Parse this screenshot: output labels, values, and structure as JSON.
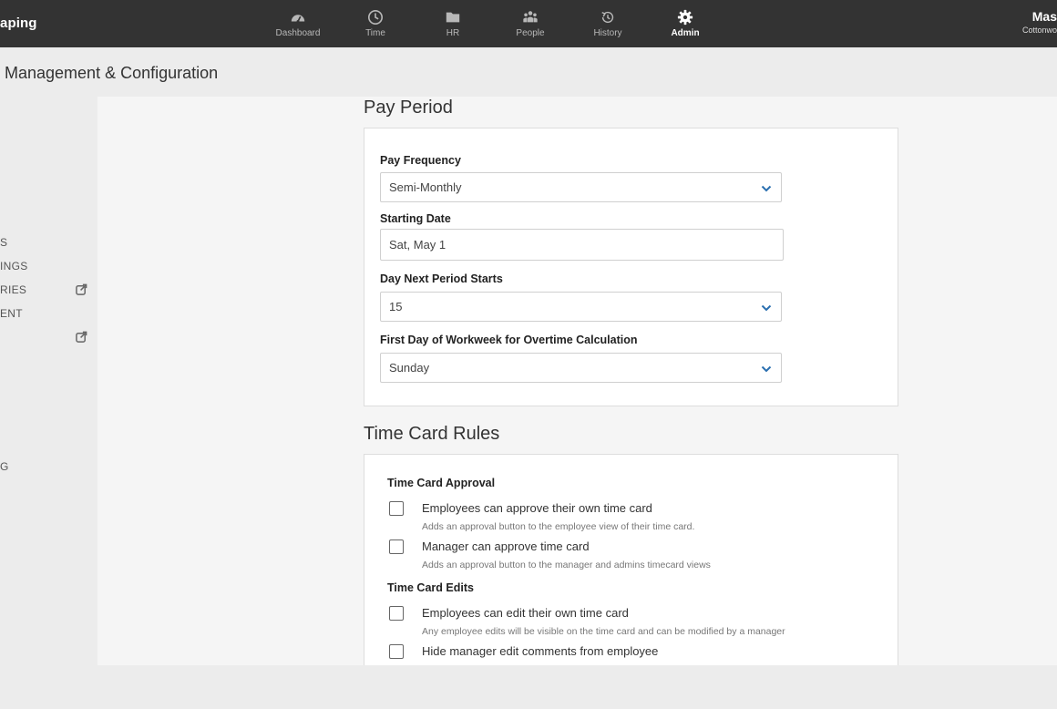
{
  "header": {
    "brand": "aping",
    "nav": [
      {
        "label": "Dashboard",
        "icon": "dashboard-icon",
        "active": false
      },
      {
        "label": "Time",
        "icon": "clock-icon",
        "active": false
      },
      {
        "label": "HR",
        "icon": "folder-icon",
        "active": false
      },
      {
        "label": "People",
        "icon": "people-icon",
        "active": false
      },
      {
        "label": "History",
        "icon": "history-icon",
        "active": false
      },
      {
        "label": "Admin",
        "icon": "gear-icon",
        "active": true
      }
    ],
    "user_name": "Mas",
    "user_company": "Cottonwo"
  },
  "page_title": "Management & Configuration",
  "sidebar": {
    "items": [
      {
        "label": "S",
        "external": false
      },
      {
        "label": "INGS",
        "external": false
      },
      {
        "label": "RIES",
        "external": true
      },
      {
        "label": "ENT",
        "external": false
      },
      {
        "label": "",
        "external": true
      },
      {
        "label": "G",
        "external": false
      }
    ]
  },
  "pay_period": {
    "title": "Pay Period",
    "pay_frequency_label": "Pay Frequency",
    "pay_frequency_value": "Semi-Monthly",
    "starting_date_label": "Starting Date",
    "starting_date_value": "Sat, May 1",
    "next_period_label": "Day Next Period Starts",
    "next_period_value": "15",
    "first_day_label": "First Day of Workweek for Overtime Calculation",
    "first_day_value": "Sunday"
  },
  "time_card_rules": {
    "title": "Time Card Rules",
    "approval_label": "Time Card Approval",
    "approval_options": [
      {
        "label": "Employees can approve their own time card",
        "description": "Adds an approval button to the employee view of their time card.",
        "checked": false
      },
      {
        "label": "Manager can approve time card",
        "description": "Adds an approval button to the manager and admins timecard views",
        "checked": false
      }
    ],
    "edits_label": "Time Card Edits",
    "edit_options": [
      {
        "label": "Employees can edit their own time card",
        "description": "Any employee edits will be visible on the time card and can be modified by a manager",
        "checked": false
      },
      {
        "label": "Hide manager edit comments from employee",
        "description": "",
        "checked": false
      }
    ]
  },
  "colors": {
    "topbar": "#333333",
    "accent_chevron": "#2a6fb0",
    "background": "#ececec",
    "content_bg": "#f5f5f5"
  }
}
